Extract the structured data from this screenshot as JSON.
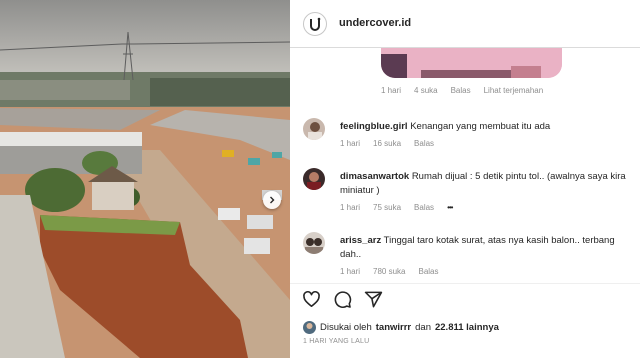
{
  "account": {
    "username": "undercover.id"
  },
  "top_meta": {
    "time": "1 hari",
    "likes": "4 suka",
    "reply": "Balas",
    "translate": "Lihat terjemahan"
  },
  "comments": [
    {
      "username": "feelingblue.girl",
      "text": "Kenangan yang membuat itu ada",
      "time": "1 hari",
      "likes": "16 suka",
      "reply": "Balas"
    },
    {
      "username": "dimasanwartok",
      "text": "Rumah dijual : 5 detik pintu tol.. (awalnya saya kira miniatur )",
      "time": "1 hari",
      "likes": "75 suka",
      "reply": "Balas",
      "more": "•••"
    },
    {
      "username": "ariss_arz",
      "text": "Tinggal taro kotak surat, atas nya kasih balon.. terbang dah..",
      "time": "1 hari",
      "likes": "780 suka",
      "reply": "Balas"
    }
  ],
  "likes_line": {
    "prefix": "Disukai oleh",
    "user": "tanwirrr",
    "connector": "dan",
    "count": "22.811 lainnya"
  },
  "post_date": "1 HARI YANG LALU",
  "icons": [
    "next-arrow-icon",
    "heart-icon",
    "comment-icon",
    "share-icon",
    "more-icon"
  ],
  "colors": {
    "text": "#262626",
    "muted": "#8e8e8e",
    "border": "#dbdbdb"
  }
}
